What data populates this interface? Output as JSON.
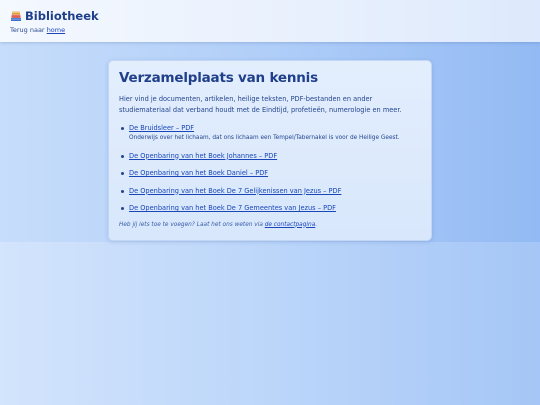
{
  "header": {
    "title": "Bibliotheek",
    "back_prefix": "Terug naar ",
    "back_link": "home"
  },
  "main": {
    "heading": "Verzamelplaats van kennis",
    "intro": "Hier vind je documenten, artikelen, heilige teksten, PDF-bestanden en ander studiemateriaal dat verband houdt met de Eindtijd, profetieën, numerologie en meer.",
    "items": [
      {
        "link": "De Bruidsleer – PDF",
        "description": "Onderwijs over het lichaam, dat ons lichaam een Tempel/Tabernakel is voor de Heilige Geest."
      },
      {
        "link": "De Openbaring van het Boek Johannes – PDF"
      },
      {
        "link": "De Openbaring van het Boek Daniel – PDF"
      },
      {
        "link": "De Openbaring van het Boek De 7 Gelijkenissen van Jezus – PDF"
      },
      {
        "link": "De Openbaring van het Boek De 7 Gemeentes van Jezus – PDF"
      }
    ],
    "footer_prefix": "Heb jij iets toe te voegen? Laat het ons weten via ",
    "footer_link": "de contactpagina",
    "footer_suffix": "."
  },
  "icons": {
    "brand": "books-icon"
  },
  "colors": {
    "accent": "#1f3f8a",
    "link": "#1a46b8",
    "card_bg": "#dde9fc"
  }
}
